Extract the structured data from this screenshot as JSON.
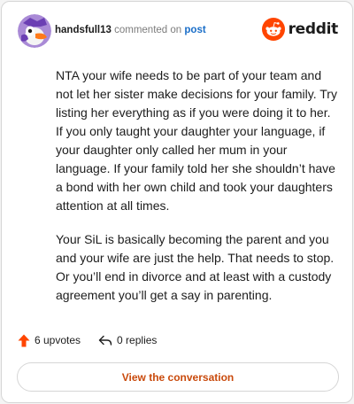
{
  "header": {
    "username": "handsfull13",
    "action_text": "commented on",
    "post_link": "post",
    "brand_name": "reddit",
    "avatar_icon": "duck-avatar-icon",
    "brand_icon": "reddit-snoo-icon",
    "brand_color": "#ff4500"
  },
  "comment": {
    "paragraphs": [
      "NTA your wife needs to be part of your team and not let her sister make decisions for your family. Try listing her everything as if you were doing it to her. If you only taught your daughter your language, if your daughter only called her mum in your language. If your family told her she shouldn’t have a bond with her own child and took your daughters attention at all times.",
      "Your SiL is basically becoming the parent and you and your wife are just the help. That needs to stop. Or you’ll end in divorce and at least with a custody agreement you’ll get a say in parenting."
    ]
  },
  "actions": {
    "upvotes_label": "6 upvotes",
    "replies_label": "0 replies",
    "upvote_icon": "upvote-arrow-icon",
    "reply_icon": "reply-arrow-icon",
    "upvote_color": "#ff4500"
  },
  "cta": {
    "label": "View the conversation",
    "color": "#c94a0c"
  }
}
